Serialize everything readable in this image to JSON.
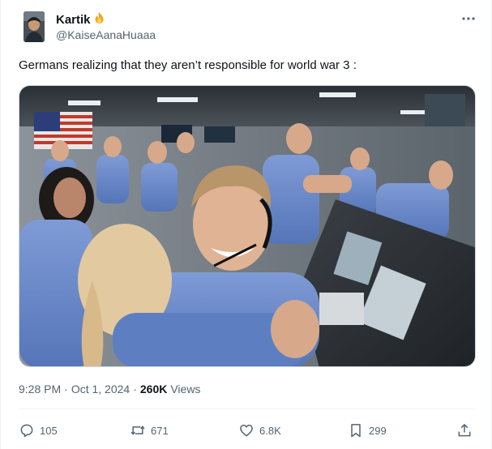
{
  "user": {
    "display_name": "Kartik",
    "handle": "@KaiseAanaHuaaa",
    "avatar_icon": "profile-photo"
  },
  "tweet": {
    "text": "Germans realizing that they aren’t responsible for world war 3 :",
    "time": "9:28 PM",
    "separator": "·",
    "date": "Oct 1, 2024",
    "views_count": "260K",
    "views_label": "Views"
  },
  "actions": {
    "replies": "105",
    "reposts": "671",
    "likes": "6.8K",
    "bookmarks": "299"
  },
  "icons": {
    "more": "more-icon",
    "reply": "reply-icon",
    "repost": "repost-icon",
    "like": "heart-icon",
    "bookmark": "bookmark-icon",
    "share": "share-icon",
    "name_emoji": "fire-icon"
  },
  "colors": {
    "text_primary": "#0f1419",
    "text_secondary": "#536471",
    "border": "#cfd9de"
  }
}
